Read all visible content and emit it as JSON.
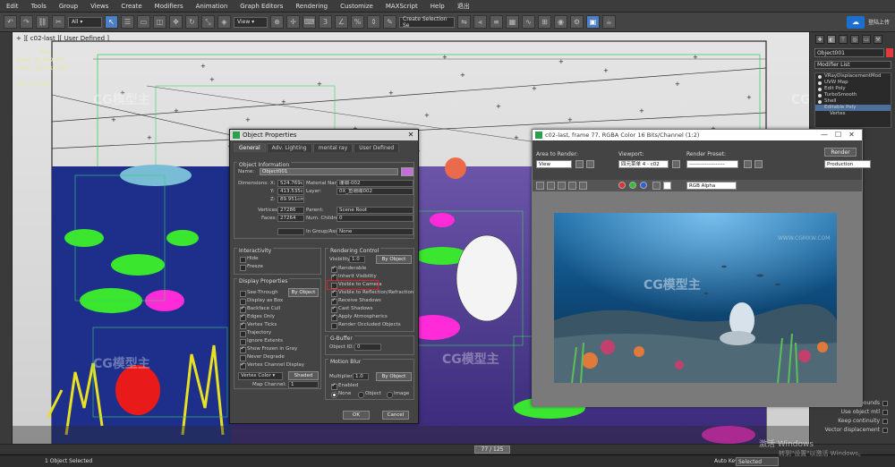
{
  "menubar": {
    "items": [
      "Edit",
      "Tools",
      "Group",
      "Views",
      "Create",
      "Modifiers",
      "Animation",
      "Graph Editors",
      "Rendering",
      "Customize",
      "MAXScript",
      "Help",
      "退出"
    ],
    "login": "登陆上传"
  },
  "toolbar": {
    "filter_all": "All",
    "view": "View",
    "selection_set": "Create Selection Se"
  },
  "viewport": {
    "label": "+ ][ c02-last ][ User Defined ]",
    "stats": {
      "total_label": "Total",
      "polys_label": "Polys:",
      "polys_value": "42,849,051",
      "verts_label": "Verts:",
      "verts_value": "102,319,043",
      "fps_label": "FPS:",
      "fps_value": "13.045"
    }
  },
  "watermark": "CG模型主",
  "watermark_url": "WWW.CGMXW.COM",
  "command_panel": {
    "object_name": "Object001",
    "modifier_list": "Modifier List",
    "modifiers": [
      "VRayDisplacementMod",
      "UVW Map",
      "Edit Poly",
      "TurboSmooth",
      "Shell",
      "Editable Poly",
      "Vertex"
    ],
    "lower_rows": [
      "Tight bounds",
      "Use object mtl",
      "Keep continuity",
      "Vector displacement"
    ]
  },
  "timeline": {
    "frame": "77 / 125"
  },
  "statusbar": {
    "selection": "1 Object Selected",
    "autokey": "Auto Key",
    "selected": "Selected"
  },
  "windows_activation": {
    "line1": "激活 Windows",
    "line2": "转到\"设置\"以激活 Windows。"
  },
  "object_properties": {
    "title": "Object Properties",
    "tabs": [
      "General",
      "Adv. Lighting",
      "mental ray",
      "User Defined"
    ],
    "info": {
      "group": "Object Information",
      "name_label": "Name:",
      "name_value": "Object001",
      "dimensions_label": "Dimensions:",
      "x_label": "X:",
      "x_value": "524.769cm",
      "y_label": "Y:",
      "y_value": "413.535cm",
      "z_label": "Z:",
      "z_value": "89.951cm",
      "material_label": "Material Name:",
      "material_value": "珊瑚-002",
      "layer_label": "Layer:",
      "layer_value": "0X_鱼珊瑚002",
      "vertices_label": "Vertices:",
      "vertices_value": "27286",
      "faces_label": "Faces:",
      "faces_value": "27264",
      "parent_label": "Parent:",
      "parent_value": "Scene Root",
      "children_label": "Num. Children:",
      "children_value": "0",
      "group_label": "In Group/Assembly:",
      "group_value": "None"
    },
    "interactivity": {
      "group": "Interactivity",
      "hide": "Hide",
      "freeze": "Freeze"
    },
    "display": {
      "group": "Display Properties",
      "by_object": "By Object",
      "items": [
        "See-Through",
        "Display as Box",
        "Backface Cull",
        "Edges Only",
        "Vertex Ticks",
        "Trajectory",
        "Ignore Extents",
        "Show Frozen in Gray",
        "Never Degrade",
        "Vertex Channel Display"
      ],
      "checked": [
        false,
        false,
        true,
        true,
        true,
        false,
        false,
        true,
        false,
        true
      ],
      "channel": "Vertex Color",
      "shaded": "Shaded",
      "map_channel_label": "Map Channel:",
      "map_channel_value": "1"
    },
    "rendering": {
      "group": "Rendering Control",
      "visibility_label": "Visibility:",
      "visibility_value": "1.0",
      "by_object": "By Object",
      "items": [
        "Renderable",
        "Inherit Visibility",
        "Visible to Camera",
        "Visible to Reflection/Refraction",
        "Receive Shadows",
        "Cast Shadows",
        "Apply Atmospherics",
        "Render Occluded Objects"
      ],
      "checked": [
        true,
        true,
        false,
        true,
        true,
        true,
        true,
        false
      ]
    },
    "gbuffer": {
      "group": "G-Buffer",
      "object_id_label": "Object ID:",
      "object_id_value": "0"
    },
    "motion_blur": {
      "group": "Motion Blur",
      "multiplier_label": "Multiplier:",
      "multiplier_value": "1.0",
      "by_object": "By Object",
      "enabled": "Enabled",
      "none": "None",
      "object": "Object",
      "image": "Image"
    },
    "ok": "OK",
    "cancel": "Cancel"
  },
  "render_frame": {
    "title": "c02-last, frame 77, RGBA Color 16 Bits/Channel (1:2)",
    "area_label": "Area to Render:",
    "area_value": "View",
    "viewport_label": "Viewport:",
    "viewport_value": "四元菜单 4 - c02",
    "preset_label": "Render Preset:",
    "preset_value": "--------------------",
    "render_btn": "Render",
    "production": "Production",
    "channel_value": "RGB Alpha"
  }
}
